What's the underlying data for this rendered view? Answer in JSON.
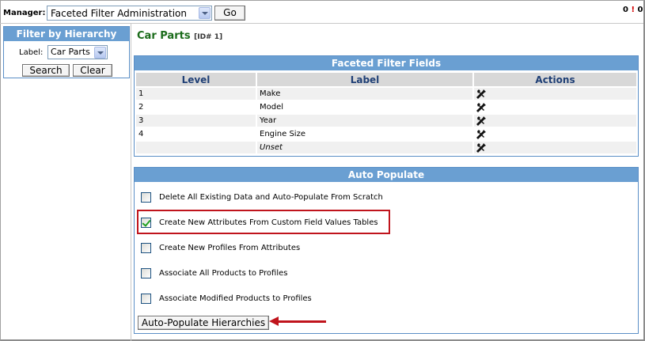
{
  "manager": {
    "label": "Manager:",
    "selected": "Faceted Filter Administration",
    "go_label": "Go",
    "status_count_left": "0",
    "status_count_right": "0"
  },
  "sidebar": {
    "title": "Filter by Hierarchy",
    "label_text": "Label:",
    "label_value": "Car Parts",
    "search_label": "Search",
    "clear_label": "Clear"
  },
  "page": {
    "title": "Car Parts",
    "id_text": "[ID# 1]"
  },
  "fields": {
    "title": "Faceted Filter Fields",
    "headers": [
      "Level",
      "Label",
      "Actions"
    ],
    "rows": [
      {
        "level": "1",
        "label": "Make"
      },
      {
        "level": "2",
        "label": "Model"
      },
      {
        "level": "3",
        "label": "Year"
      },
      {
        "level": "4",
        "label": "Engine Size"
      },
      {
        "level": "",
        "label": "Unset"
      }
    ]
  },
  "auto": {
    "title": "Auto Populate",
    "options": [
      {
        "label": "Delete All Existing Data and Auto-Populate From Scratch",
        "checked": false
      },
      {
        "label": "Create New Attributes From Custom Field Values Tables",
        "checked": true
      },
      {
        "label": "Create New Profiles From Attributes",
        "checked": false
      },
      {
        "label": "Associate All Products to Profiles",
        "checked": false
      },
      {
        "label": "Associate Modified Products to Profiles",
        "checked": false
      }
    ],
    "button_label": "Auto-Populate Hierarchies"
  },
  "colors": {
    "panel_header": "#6a9fd2",
    "title_green": "#1a6b1a",
    "annotation_red": "#c0141c"
  }
}
